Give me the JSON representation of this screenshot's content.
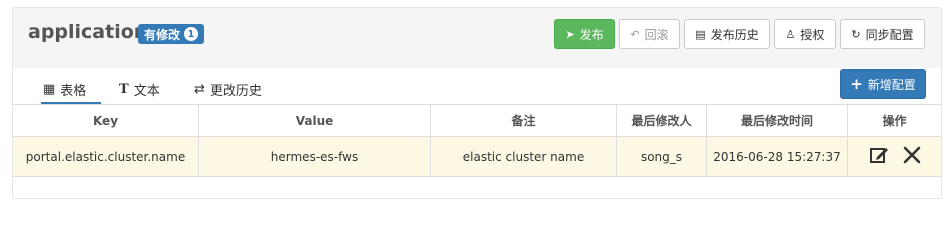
{
  "header": {
    "title": "application",
    "badge_label": "有修改",
    "badge_count": "1",
    "buttons": {
      "publish": "发布",
      "rollback": "回滚",
      "history": "发布历史",
      "auth": "授权",
      "sync": "同步配置"
    }
  },
  "tabs": [
    {
      "label": "表格",
      "active": true
    },
    {
      "label": "文本",
      "active": false
    },
    {
      "label": "更改历史",
      "active": false
    }
  ],
  "add_button": "新增配置",
  "table": {
    "columns": [
      "Key",
      "Value",
      "备注",
      "最后修改人",
      "最后修改时间",
      "操作"
    ],
    "rows": [
      {
        "key": "portal.elastic.cluster.name",
        "value": "hermes-es-fws",
        "comment": "elastic cluster name",
        "modifier": "song_s",
        "modified_time": "2016-06-28 15:27:37"
      }
    ]
  },
  "icons": {
    "publish": "send-icon",
    "rollback": "undo-icon",
    "history": "document-icon",
    "auth": "user-icon",
    "sync": "refresh-icon",
    "add": "plus-icon",
    "edit": "edit-icon",
    "delete": "close-icon"
  },
  "colors": {
    "primary": "#337ab7",
    "success": "#5cb85c",
    "highlight_row": "#fcf8e3"
  }
}
